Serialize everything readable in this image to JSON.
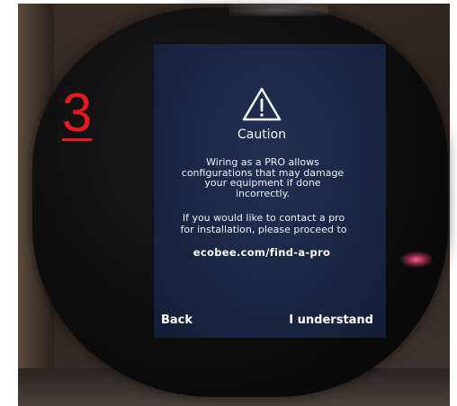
{
  "annotation": {
    "step_number": "3",
    "color": "#e8191c"
  },
  "screen": {
    "icon": "warning-triangle-icon",
    "title": "Caution",
    "body": "Wiring as a PRO allows\nconfigurations that may damage\nyour equipment if done\nincorrectly.",
    "contact": "If you would like to contact a pro\nfor installation, please proceed to",
    "url": "ecobee.com/find-a-pro",
    "back_label": "Back",
    "understand_label": "I understand",
    "background_color": "#1b2644",
    "text_color": "#f2f4f8"
  }
}
